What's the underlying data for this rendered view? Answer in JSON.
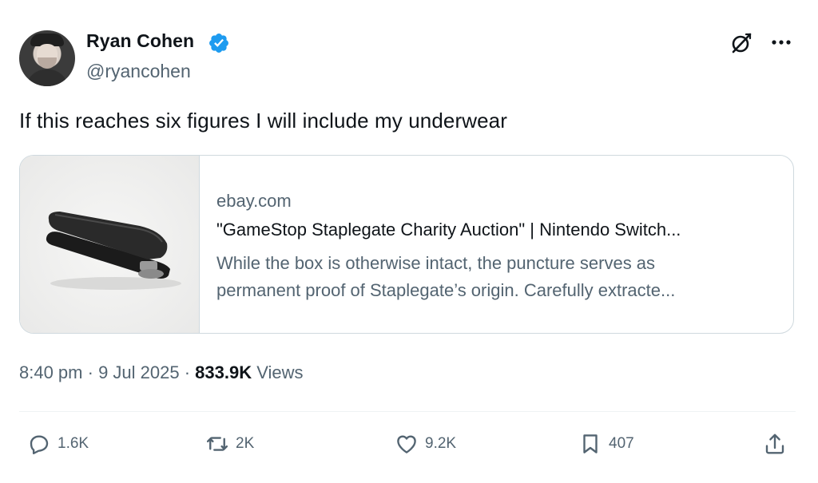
{
  "user": {
    "name": "Ryan Cohen",
    "handle": "@ryancohen",
    "verified": true,
    "verified_color": "#1d9bf0"
  },
  "tweet": {
    "text": "If this reaches six figures I will include my underwear"
  },
  "card": {
    "domain": "ebay.com",
    "title": "\"GameStop Staplegate Charity Auction\" | Nintendo Switch...",
    "description_line1": "While the box is otherwise intact, the puncture serves as",
    "description_line2": "permanent proof of Staplegate’s origin. Carefully extracte..."
  },
  "meta": {
    "time": "8:40 pm",
    "sep1": " · ",
    "date": "9 Jul 2025",
    "sep2": " · ",
    "views_count": "833.9K",
    "views_label": " Views"
  },
  "actions": {
    "replies": "1.6K",
    "reposts": "2K",
    "likes": "9.2K",
    "bookmarks": "407"
  },
  "icons": {
    "header": [
      "grok-icon",
      "more-icon"
    ],
    "actions": [
      "reply-icon",
      "repost-icon",
      "like-icon",
      "bookmark-icon",
      "share-icon"
    ]
  },
  "colors": {
    "text_primary": "#0f1419",
    "text_secondary": "#536471",
    "border": "#cfd9de"
  }
}
